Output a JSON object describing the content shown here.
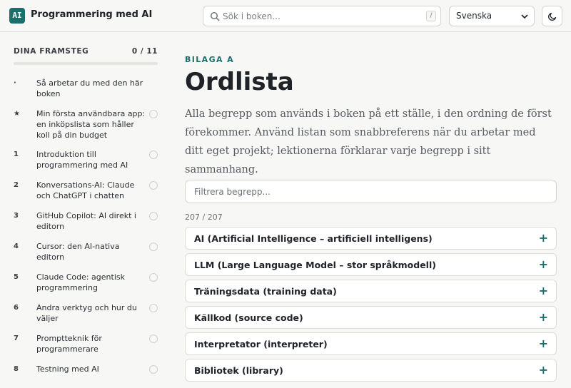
{
  "header": {
    "logo_text": "AI",
    "title": "Programmering med AI",
    "search_placeholder": "Sök i boken...",
    "search_shortcut": "/",
    "language_selected": "Svenska"
  },
  "sidebar": {
    "progress_label": "DINA FRAMSTEG",
    "progress_count": "0 / 11",
    "progress_fraction": 0,
    "items": [
      {
        "num": "·",
        "label": "Så arbetar du med den här boken",
        "has_check": false
      },
      {
        "num": "★",
        "label": "Min första användbara app: en inköpslista som håller koll på din budget",
        "has_check": true
      },
      {
        "num": "1",
        "label": "Introduktion till programmering med AI",
        "has_check": true
      },
      {
        "num": "2",
        "label": "Konversations-AI: Claude och ChatGPT i chatten",
        "has_check": true
      },
      {
        "num": "3",
        "label": "GitHub Copilot: AI direkt i editorn",
        "has_check": true
      },
      {
        "num": "4",
        "label": "Cursor: den AI-nativa editorn",
        "has_check": true
      },
      {
        "num": "5",
        "label": "Claude Code: agentisk programmering",
        "has_check": true
      },
      {
        "num": "6",
        "label": "Andra verktyg och hur du väljer",
        "has_check": true
      },
      {
        "num": "7",
        "label": "Promptteknik för programmerare",
        "has_check": true
      },
      {
        "num": "8",
        "label": "Testning med AI",
        "has_check": true
      }
    ]
  },
  "main": {
    "eyebrow": "BILAGA A",
    "title": "Ordlista",
    "intro": "Alla begrepp som används i boken på ett ställe, i den ordning de först förekommer. Använd listan som snabbreferens när du arbetar med ditt eget projekt; lektionerna förklarar varje begrepp i sitt sammanhang.",
    "filter_placeholder": "Filtrera begrepp...",
    "count": "207 / 207",
    "terms": [
      "AI (Artificial Intelligence – artificiell intelligens)",
      "LLM (Large Language Model – stor språkmodell)",
      "Träningsdata (training data)",
      "Källkod (source code)",
      "Interpretator (interpreter)",
      "Bibliotek (library)"
    ],
    "expand_symbol": "+"
  },
  "colors": {
    "accent": "#1b6f6a",
    "background": "#f7f7f5",
    "text": "#1f2328"
  },
  "icons": {
    "search": "search-icon",
    "theme": "moon-icon",
    "select": "chevron-down-icon"
  }
}
